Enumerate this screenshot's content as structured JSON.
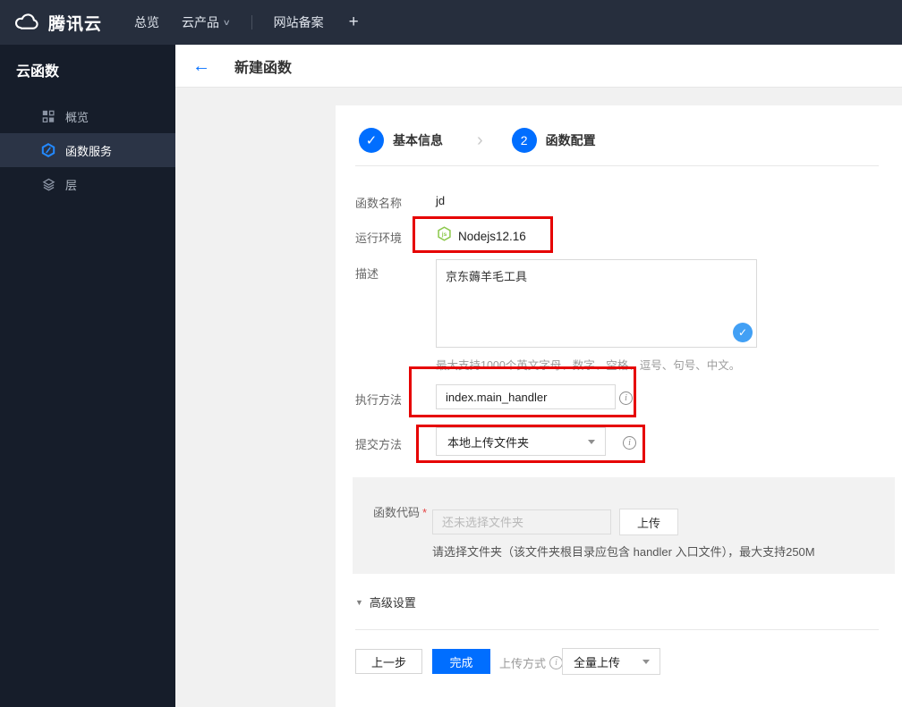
{
  "topbar": {
    "brand": "腾讯云",
    "nav_overview": "总览",
    "nav_products": "云产品",
    "caret": "∨",
    "nav_icp": "网站备案",
    "nav_add": "+"
  },
  "sidebar": {
    "title": "云函数",
    "items": [
      {
        "label": "概览"
      },
      {
        "label": "函数服务"
      },
      {
        "label": "层"
      }
    ]
  },
  "header": {
    "back_arrow": "←",
    "title": "新建函数"
  },
  "steps": {
    "step1_check": "✓",
    "step1_label": "基本信息",
    "chevron": "›",
    "step2_number": "2",
    "step2_label": "函数配置"
  },
  "form": {
    "name_label": "函数名称",
    "name_value": "jd",
    "runtime_label": "运行环境",
    "runtime_icon_text": "js",
    "runtime_value": "Nodejs12.16",
    "desc_label": "描述",
    "desc_value": "京东薅羊毛工具",
    "desc_check": "✓",
    "desc_hint": "最大支持1000个英文字母、数字、空格、逗号、句号、中文。",
    "handler_label": "执行方法",
    "handler_value": "index.main_handler",
    "info_glyph": "i",
    "submit_label": "提交方法",
    "submit_value": "本地上传文件夹",
    "code_label": "函数代码",
    "code_required": "*",
    "code_placeholder": "还未选择文件夹",
    "upload_button": "上传",
    "code_hint": "请选择文件夹（该文件夹根目录应包含 handler 入口文件），最大支持250M",
    "advanced_caret": "▼",
    "advanced_label": "高级设置"
  },
  "footer": {
    "prev_button": "上一步",
    "finish_button": "完成",
    "upload_mode_label": "上传方式",
    "upload_mode_value": "全量上传"
  },
  "colors": {
    "accent_blue": "#006eff",
    "annotation_red": "#e60000",
    "node_green": "#8cc84b",
    "check_blue": "#42a0f5",
    "topbar_bg": "#262e3d",
    "sidebar_bg": "#161d2a",
    "sidebar_active_bg": "#2b3446"
  }
}
